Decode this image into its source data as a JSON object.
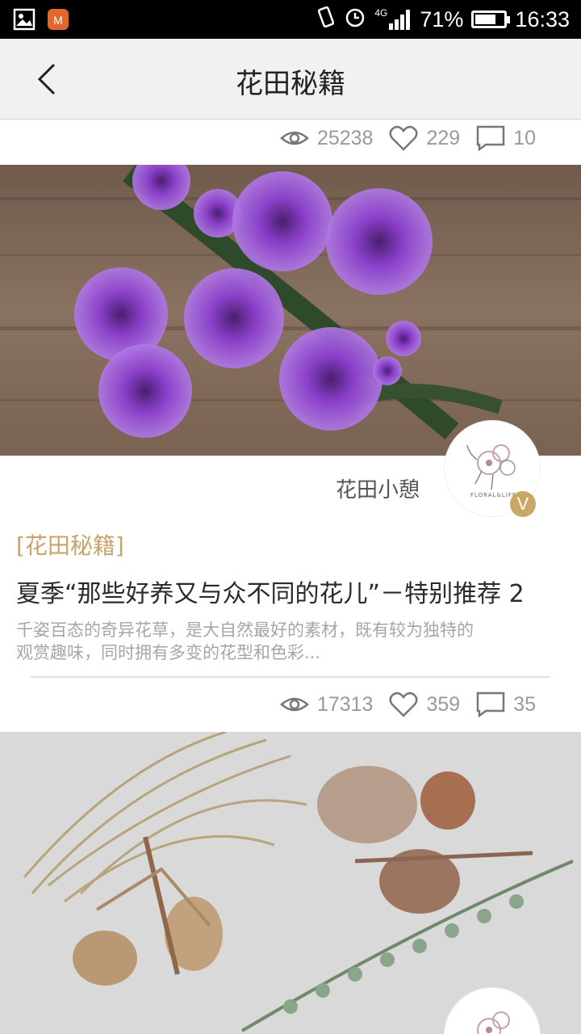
{
  "status_bar": {
    "battery": "71%",
    "time": "16:33",
    "network": "4G",
    "battery_level": 0.71
  },
  "nav": {
    "title": "花田秘籍"
  },
  "top_card": {
    "views": "25238",
    "likes": "229",
    "comments": "10"
  },
  "articles": [
    {
      "author": "花田小憩",
      "verified_badge": "V",
      "avatar_text": "FLORAL&LIFE",
      "tag": "[花田秘籍]",
      "title": "夏季“那些好养又与众不同的花儿”－特别推荐 2",
      "desc_line1": "千姿百态的奇异花草，是大自然最好的素材，既有较为独特的",
      "desc_line2": "观赏趣味，同时拥有多变的花型和色彩...",
      "views": "17313",
      "likes": "359",
      "comments": "35"
    }
  ],
  "colors": {
    "accent": "#c8a46a",
    "badge": "#c9a865"
  }
}
